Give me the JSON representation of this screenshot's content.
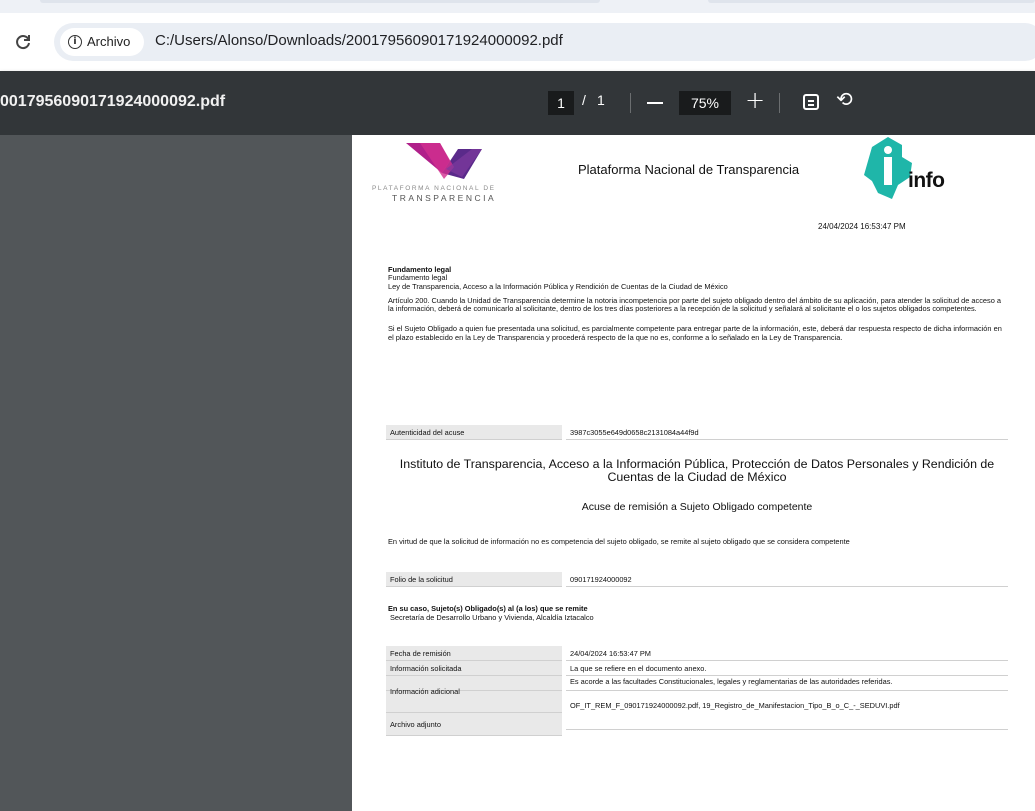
{
  "browser": {
    "site_info_label": "Archivo",
    "url": "C:/Users/Alonso/Downloads/20017956090171924000092.pdf",
    "reload_glyph": "C"
  },
  "pdf_toolbar": {
    "title": "0017956090171924000092.pdf",
    "current_page": "1",
    "page_separator": "/",
    "total_pages": "1",
    "zoom": "75%",
    "zoom_in_glyph": "+",
    "rotate_glyph": "⟲"
  },
  "document": {
    "pnt_subtitle_1": "PLATAFORMA NACIONAL DE",
    "pnt_subtitle_2": "TRANSPARENCIA",
    "header_title": "Plataforma Nacional de Transparencia",
    "info_logo_text": "info",
    "date": "24/04/2024 16:53:47 PM",
    "fundamento_heading": "Fundamento legal",
    "fundamento_sub": "Fundamento legal",
    "ley": "Ley de Transparencia, Acceso a la Información Pública y Rendición de Cuentas de la Ciudad de México",
    "articulo": "Artículo 200. Cuando la Unidad de Transparencia determine la notoria incompetencia por parte del sujeto obligado dentro del ámbito de su aplicación, para atender la solicitud de acceso a la información, deberá de comunicarlo al solicitante, dentro de los tres días posteriores a la recepción de la solicitud y señalará al solicitante el o los sujetos obligados competentes.",
    "parcial": "Si el Sujeto Obligado a quien fue presentada una solicitud, es parcialmente competente para entregar parte de la información, este, deberá dar respuesta respecto de dicha información en el plazo establecido en la Ley de Transparencia y procederá respecto de la que no es, conforme a lo señalado en la Ley de Transparencia.",
    "autenticidad_label": "Autenticidad del acuse",
    "autenticidad_value": "3987c3055e649d0658c2131084a44f9d",
    "institute_title": "Instituto de Transparencia, Acceso a la Información Pública, Protección de Datos Personales y Rendición de Cuentas de la Ciudad de México",
    "acuse_title": "Acuse de remisión a Sujeto Obligado competente",
    "virtud": "En virtud de que la solicitud de información no es competencia del sujeto obligado, se remite al sujeto obligado que se considera competente",
    "folio_label": "Folio de la solicitud",
    "folio_value": "090171924000092",
    "caso_heading": "En su caso, Sujeto(s) Obligado(s) al (a los) que se remite",
    "caso_value": "Secretaría de Desarrollo Urbano y Vivienda, Alcaldía Iztacalco",
    "fecha_label": "Fecha de remisión",
    "fecha_value": "24/04/2024 16:53:47 PM",
    "info_sol_label": "Información solicitada",
    "info_sol_value": "La que se refiere en el documento anexo.",
    "info_adic_label": "Información adicional",
    "info_adic_value": "Es acorde a las facultades Constitucionales, legales y reglamentarias de las autoridades referidas.",
    "archivo_label": "Archivo adjunto",
    "archivo_value": "OF_IT_REM_F_090171924000092.pdf, 19_Registro_de_Manifestacion_Tipo_B_o_C_-_SEDUVI.pdf"
  },
  "colors": {
    "toolbar_bg": "#323639",
    "viewer_bg": "#525659",
    "info_logo": "#1fb6a9",
    "pnt_logo_magenta": "#b0208a",
    "pnt_logo_purple": "#5a2a8a"
  }
}
